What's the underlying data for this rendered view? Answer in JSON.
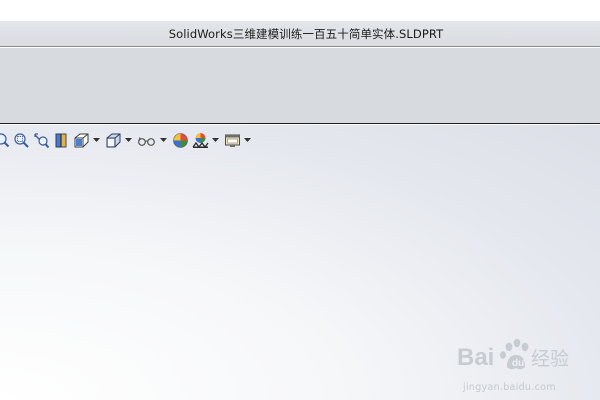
{
  "window": {
    "title": "SolidWorks三维建模训练一百五十简单实体.SLDPRT"
  },
  "heads_up_toolbar": {
    "tools": [
      {
        "icon": "zoom-to-fit-icon",
        "has_dropdown": false
      },
      {
        "icon": "zoom-to-area-icon",
        "has_dropdown": false
      },
      {
        "icon": "previous-view-icon",
        "has_dropdown": false
      },
      {
        "icon": "section-view-icon",
        "has_dropdown": false
      },
      {
        "icon": "view-orientation-icon",
        "has_dropdown": true
      },
      {
        "icon": "display-style-icon",
        "has_dropdown": true
      },
      {
        "icon": "hide-show-items-icon",
        "has_dropdown": true
      },
      {
        "icon": "edit-appearance-icon",
        "has_dropdown": false
      },
      {
        "icon": "apply-scene-icon",
        "has_dropdown": true
      },
      {
        "icon": "view-settings-icon",
        "has_dropdown": true
      }
    ]
  },
  "watermark": {
    "logo": "Bai经验",
    "text": "jingyan.baidu.com"
  }
}
